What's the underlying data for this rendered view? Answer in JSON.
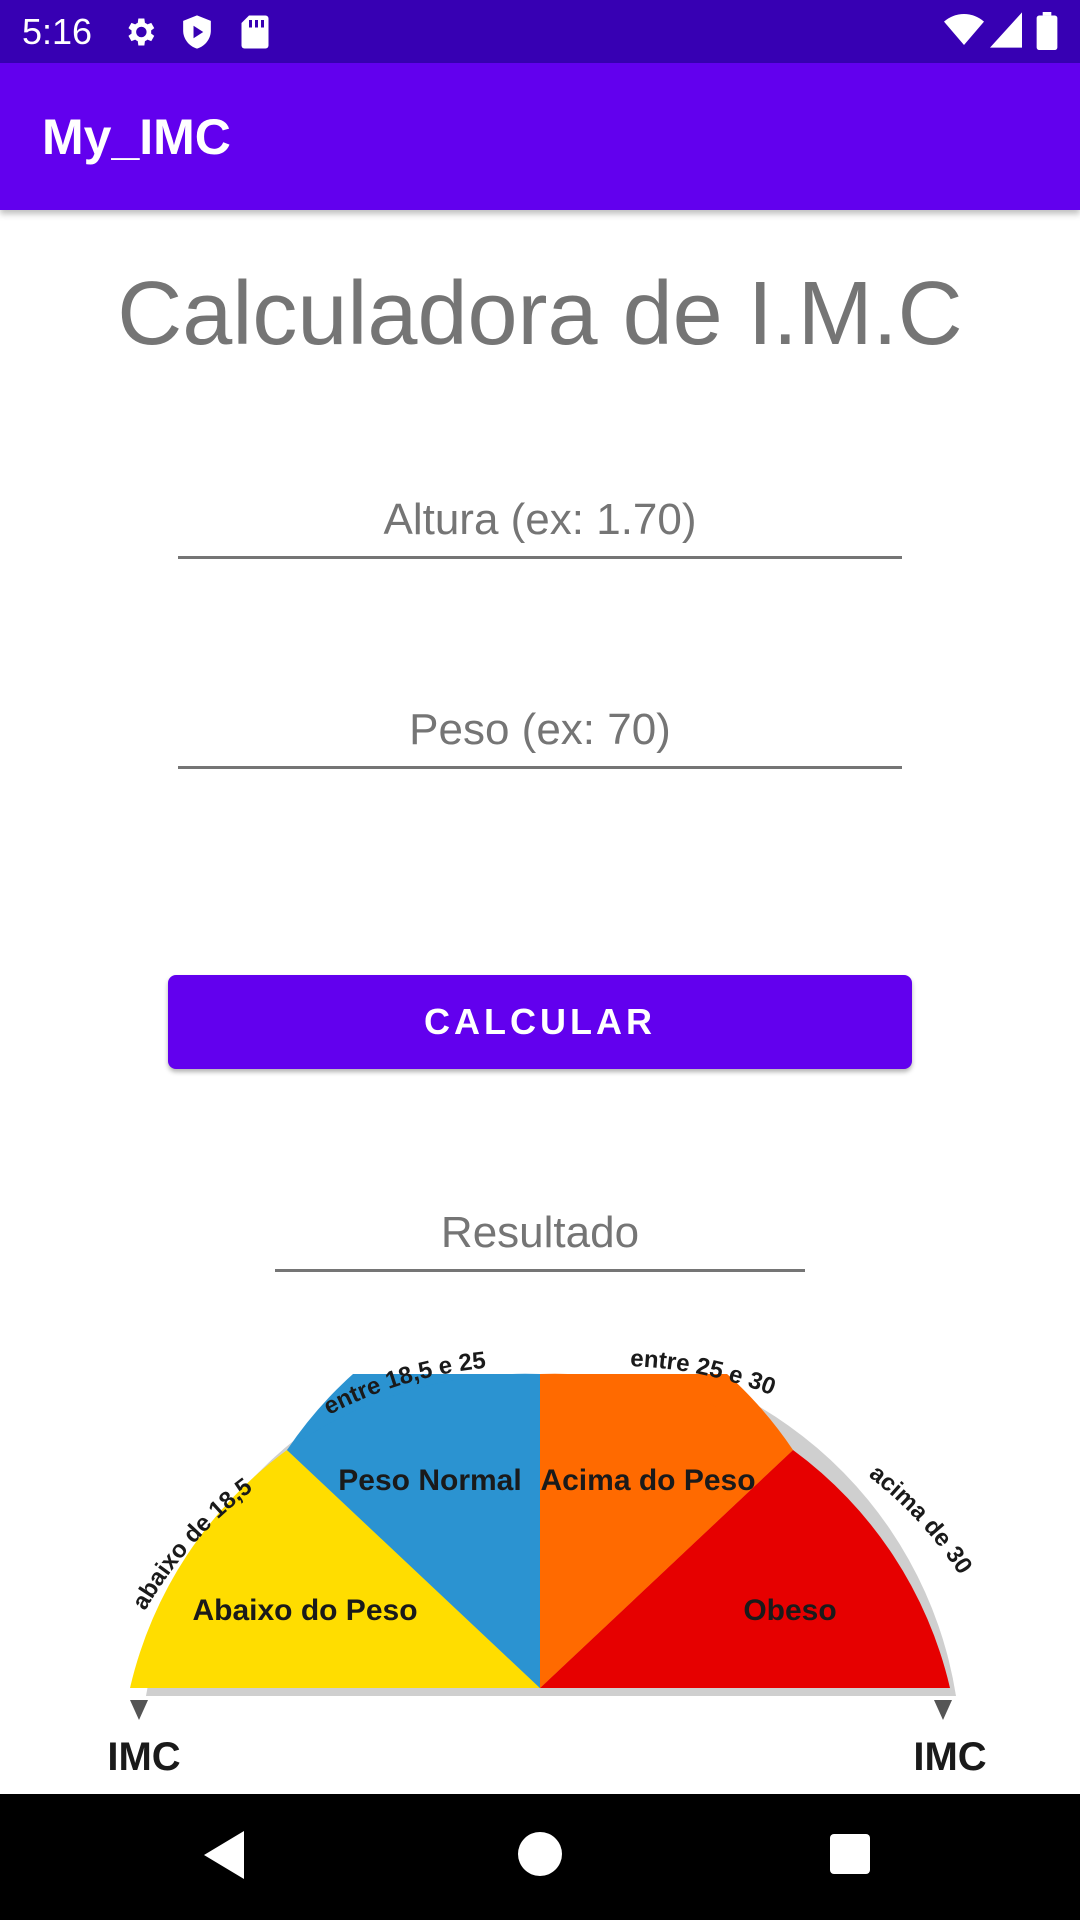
{
  "status_bar": {
    "time": "5:16",
    "left_icons": [
      "gear-icon",
      "shield-play-icon",
      "sd-card-icon"
    ],
    "right_icons": [
      "wifi-icon",
      "signal-icon",
      "battery-icon"
    ],
    "background": "#3700b3"
  },
  "app_bar": {
    "title": "My_IMC",
    "background": "#6200ee"
  },
  "main": {
    "title": "Calculadora de I.M.C",
    "altura_placeholder": "Altura (ex: 1.70)",
    "altura_value": "",
    "peso_placeholder": "Peso (ex: 70)",
    "peso_value": "",
    "calc_button_label": "CALCULAR",
    "resultado_placeholder": "Resultado",
    "resultado_value": ""
  },
  "gauge": {
    "segments": [
      {
        "label": "Abaixo do Peso",
        "range": "abaixo de 18,5",
        "color": "#ffdd00"
      },
      {
        "label": "Peso Normal",
        "range": "entre 18,5 e 25",
        "color": "#2b93d1"
      },
      {
        "label": "Acima do Peso",
        "range": "entre 25 e 30",
        "color": "#ff6a00"
      },
      {
        "label": "Obeso",
        "range": "acima de 30",
        "color": "#e60000"
      }
    ],
    "left_marker": "IMC",
    "right_marker": "IMC"
  },
  "nav_bar": {
    "icons": [
      "back-icon",
      "home-icon",
      "recents-icon"
    ]
  }
}
